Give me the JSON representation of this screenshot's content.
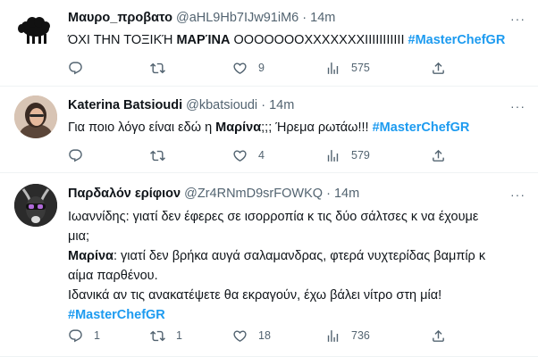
{
  "tweets": [
    {
      "name": "Μαυρο_προβατο",
      "handle": "@aHL9Hb7IJw91iM6",
      "dot": "·",
      "time": "14m",
      "more": "···",
      "text_before": "ΌΧΙ ΤΗΝ ΤΟΞΙΚΉ ",
      "text_bold": "ΜΑΡΊΝΑ",
      "text_after": " OOOOOOOXXXXXXXIIIIIIIIIII ",
      "hashtag": "#MasterChefGR",
      "reply_count": "",
      "retweet_count": "",
      "like_count": "9",
      "view_count": "575"
    },
    {
      "name": "Katerina Batsioudi",
      "handle": "@kbatsioudi",
      "dot": "·",
      "time": "14m",
      "more": "···",
      "text_before": "Για ποιο λόγο είναι εδώ η ",
      "text_bold": "Μαρίνα",
      "text_after": ";;; Ήρεμα ρωτάω!!! ",
      "hashtag": "#MasterChefGR",
      "reply_count": "",
      "retweet_count": "",
      "like_count": "4",
      "view_count": "579"
    },
    {
      "name": "Παρδαλόν ερίφιον",
      "handle": "@Zr4RNmD9srFOWKQ",
      "dot": "·",
      "time": "14m",
      "more": "···",
      "line1": "Ιωαννίδης: γιατί δεν έφερες σε ισορροπία κ τις δύο σάλτσες κ να έχουμε",
      "line2": "μια;",
      "bold2": "Μαρίνα",
      "line3": ": γιατί δεν βρήκα αυγά σαλαμανδρας, φτερά νυχτερίδας βαμπίρ κ",
      "line4": "αίμα παρθένου.",
      "line5": "Ιδανικά αν τις ανακατέψετε θα εκραγούν, έχω βάλει νίτρο στη μία!",
      "hashtag": "#MasterChefGR",
      "reply_count": "1",
      "retweet_count": "1",
      "like_count": "18",
      "view_count": "736"
    }
  ],
  "icons": {
    "reply": "reply-icon",
    "retweet": "retweet-icon",
    "like": "heart-icon",
    "views": "views-icon",
    "share": "share-icon",
    "more": "more-icon"
  },
  "colors": {
    "hashtag": "#1d9bf0",
    "secondary_text": "#536471",
    "divider": "#eff3f4"
  }
}
